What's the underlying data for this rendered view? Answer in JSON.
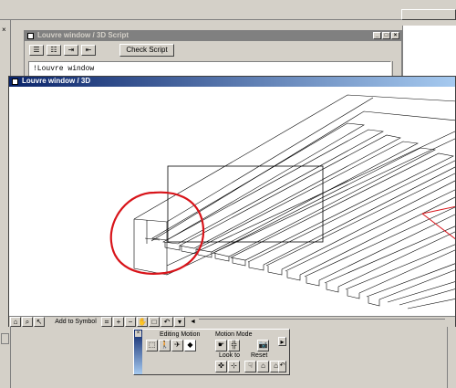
{
  "script_window": {
    "title": "Louvre window / 3D Script",
    "check_script_label": "Check Script",
    "script_text": "!Louvre window"
  },
  "view_window": {
    "title": "Louvre window / 3D",
    "add_to_symbol_label": "Add to Symbol"
  },
  "motion_palette": {
    "editing_motion_label": "Editing Motion",
    "motion_mode_label": "Motion Mode",
    "look_to_label": "Look to",
    "reset_label": "Reset"
  },
  "colors": {
    "annotation_circle": "#d8141a",
    "title_active": "#0a246a",
    "title_inactive": "#808080"
  }
}
